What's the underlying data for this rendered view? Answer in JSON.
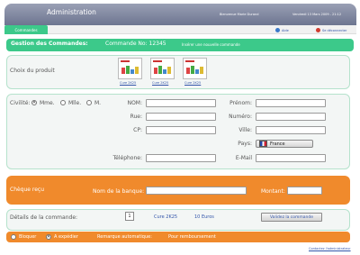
{
  "header": {
    "title": "Administration",
    "welcome": "Bienvenue Marie Durand",
    "datetime": "Vendredi 13 Mars 2009 - 21:12"
  },
  "tabs": [
    {
      "label": "Commandes",
      "active": true
    }
  ],
  "toplinks": {
    "help": "Aide",
    "logout": "Se déconnecter"
  },
  "titlebar": {
    "section": "Gestion des Commandes:",
    "order_no": "Commande No: 12345",
    "new_order": "Insérer une nouvelle commande"
  },
  "product": {
    "label": "Choix du produit",
    "items": [
      {
        "name": "Cure 2K25"
      },
      {
        "name": "Cure 2K25"
      },
      {
        "name": "Cure 2K25"
      }
    ]
  },
  "client": {
    "civilite_label": "Civilité:",
    "civilites": [
      "Mme.",
      "Mlle.",
      "M."
    ],
    "selected_civilite": "Mme.",
    "nom": "NOM:",
    "prenom": "Prénom:",
    "rue": "Rue:",
    "numero": "Numéro:",
    "cp": "CP:",
    "ville": "Ville:",
    "pays": "Pays:",
    "pays_value": "France",
    "telephone": "Téléphone:",
    "email": "E-Mail"
  },
  "cheque": {
    "label": "Chèque reçu",
    "banque": "Nom de la banque:",
    "montant": "Montant:"
  },
  "details": {
    "label": "Détails de la commande:",
    "quantity": "1",
    "product": "Cure 2K25",
    "price": "10 Euros",
    "validate": "Validez la commande"
  },
  "status": {
    "bloquer": "Bloquer",
    "expedier": "A expédier",
    "remarque": "Remarque automatique:",
    "remarque_value": "Pour remboursement",
    "selected": "A expédier"
  },
  "footer": {
    "contact": "Contactez l'administrateur"
  },
  "colors": {
    "header": "#7d8399",
    "accent_green": "#3cc98a",
    "accent_orange": "#f08a2c"
  }
}
